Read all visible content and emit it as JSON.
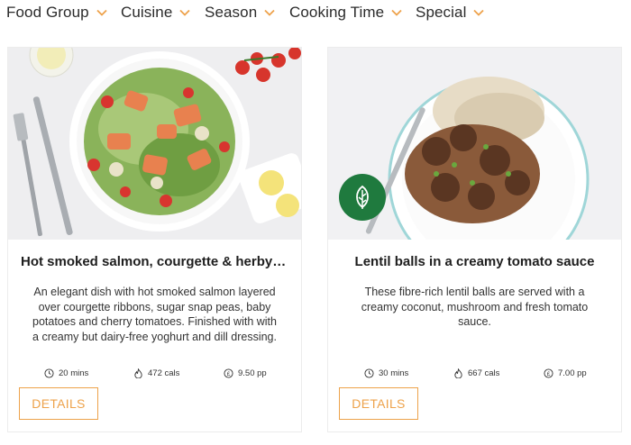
{
  "filters": [
    {
      "label": "Food Group"
    },
    {
      "label": "Cuisine"
    },
    {
      "label": "Season"
    },
    {
      "label": "Cooking Time"
    },
    {
      "label": "Special"
    }
  ],
  "accent_color": "#eda24a",
  "cards": [
    {
      "title": "Hot smoked salmon, courgette & herby yo...",
      "description": "An elegant dish with hot smoked salmon layered over courgette ribbons, sugar snap peas, baby potatoes and cherry tomatoes. Finished with with a creamy but dairy-free yoghurt and dill dressing.",
      "time": "20 mins",
      "cals": "472 cals",
      "price": "9.50 pp",
      "button_label": "DETAILS"
    },
    {
      "title": "Lentil balls in a creamy tomato sauce",
      "description": "These fibre-rich lentil balls are served with a creamy coconut, mushroom and fresh tomato sauce.",
      "time": "30 mins",
      "cals": "667 cals",
      "price": "7.00 pp",
      "button_label": "DETAILS",
      "badge_icon": "leaf-icon"
    }
  ]
}
